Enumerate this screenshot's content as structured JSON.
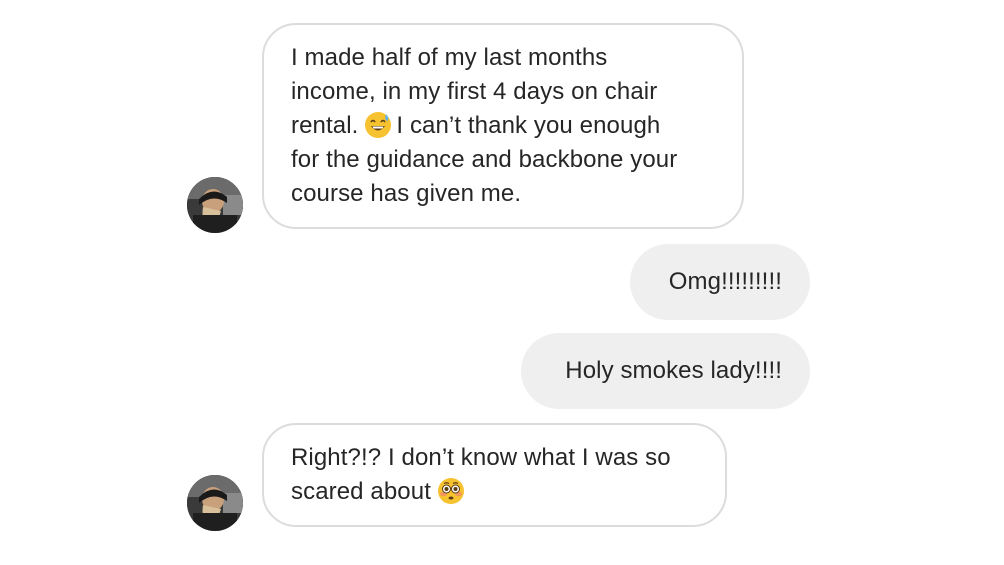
{
  "conversation": {
    "messages": [
      {
        "direction": "received",
        "lines_before": [
          "I made half of my last months",
          "income, in my first 4 days on chair"
        ],
        "inline_before_emoji": "rental.",
        "emoji": "grinning-face-with-sweat-emoji",
        "inline_after_emoji": "I can’t thank you enough",
        "lines_after": [
          "for the guidance and backbone your",
          "course has given me."
        ]
      },
      {
        "direction": "sent",
        "text": "Omg!!!!!!!!!"
      },
      {
        "direction": "sent",
        "text": "Holy smokes lady!!!!"
      },
      {
        "direction": "received",
        "line_1": "Right?!? I don’t know what I was so",
        "inline_before_emoji": "scared about",
        "emoji": "flushed-face-emoji"
      }
    ]
  },
  "colors": {
    "received_bubble_border": "#dcdcdc",
    "received_bubble_bg": "#ffffff",
    "sent_bubble_bg": "#efefef",
    "text": "#262626"
  }
}
